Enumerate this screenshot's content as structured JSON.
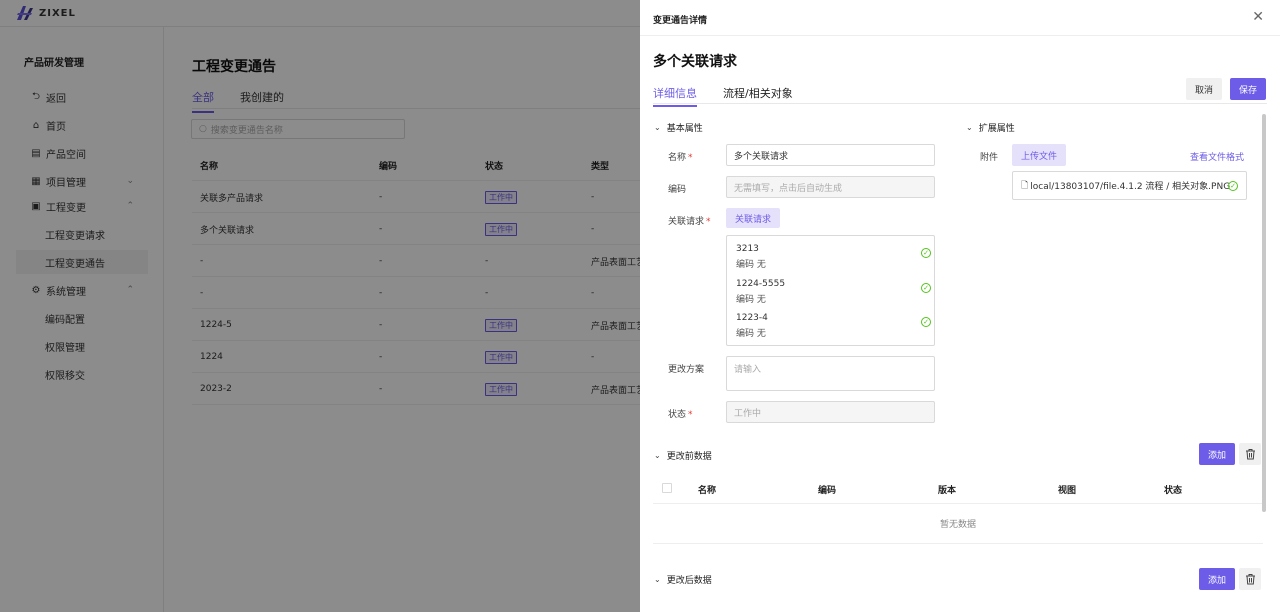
{
  "app": {
    "logo_text": "ZIXEL"
  },
  "sidebar": {
    "title": "产品研发管理",
    "items": [
      {
        "label": "返回",
        "icon": "back-icon"
      },
      {
        "label": "首页",
        "icon": "home-icon"
      },
      {
        "label": "产品空间",
        "icon": "product-space-icon"
      },
      {
        "label": "项目管理",
        "icon": "grid-icon"
      },
      {
        "label": "工程变更",
        "icon": "change-icon"
      },
      {
        "label": "工程变更请求"
      },
      {
        "label": "工程变更通告"
      },
      {
        "label": "系统管理",
        "icon": "gear-icon"
      },
      {
        "label": "编码配置"
      },
      {
        "label": "权限管理"
      },
      {
        "label": "权限移交"
      }
    ]
  },
  "main": {
    "title": "工程变更通告",
    "tabs": [
      "全部",
      "我创建的"
    ],
    "search_placeholder": "搜索变更通告名称",
    "table": {
      "headers": [
        "名称",
        "编码",
        "状态",
        "类型"
      ],
      "rows": [
        {
          "name": "关联多产品请求",
          "code": "-",
          "status": "工作中",
          "type": "-"
        },
        {
          "name": "多个关联请求",
          "code": "-",
          "status": "工作中",
          "type": "-"
        },
        {
          "name": "-",
          "code": "-",
          "status": "-",
          "type": "产品表面工艺"
        },
        {
          "name": "-",
          "code": "-",
          "status": "-",
          "type": "-"
        },
        {
          "name": "1224-5",
          "code": "-",
          "status": "工作中",
          "type": "产品表面工艺"
        },
        {
          "name": "1224",
          "code": "-",
          "status": "工作中",
          "type": "-"
        },
        {
          "name": "2023-2",
          "code": "-",
          "status": "工作中",
          "type": "产品表面工艺"
        }
      ]
    }
  },
  "drawer": {
    "header": "变更通告详情",
    "title": "多个关联请求",
    "tabs": [
      "详细信息",
      "流程/相关对象"
    ],
    "cancel": "取消",
    "save": "保存",
    "basic": {
      "title": "基本属性",
      "name_label": "名称",
      "name_value": "多个关联请求",
      "code_label": "编码",
      "code_placeholder": "无需填写，点击后自动生成",
      "rel_label": "关联请求",
      "rel_button": "关联请求",
      "related": [
        {
          "name": "3213",
          "code": "编码 无"
        },
        {
          "name": "1224-5555",
          "code": "编码 无"
        },
        {
          "name": "1223-4",
          "code": "编码 无"
        }
      ],
      "plan_label": "更改方案",
      "plan_placeholder": "请输入",
      "status_label": "状态",
      "status_value": "工作中"
    },
    "ext": {
      "title": "扩展属性",
      "attach_label": "附件",
      "upload_button": "上传文件",
      "view_formats": "查看文件格式",
      "file": "local/13803107/file.4.1.2 流程 / 相关对象.PNG"
    },
    "before": {
      "title": "更改前数据",
      "add": "添加",
      "headers": [
        "名称",
        "编码",
        "版本",
        "视图",
        "状态"
      ],
      "empty": "暂无数据"
    },
    "after": {
      "title": "更改后数据",
      "add": "添加"
    }
  }
}
